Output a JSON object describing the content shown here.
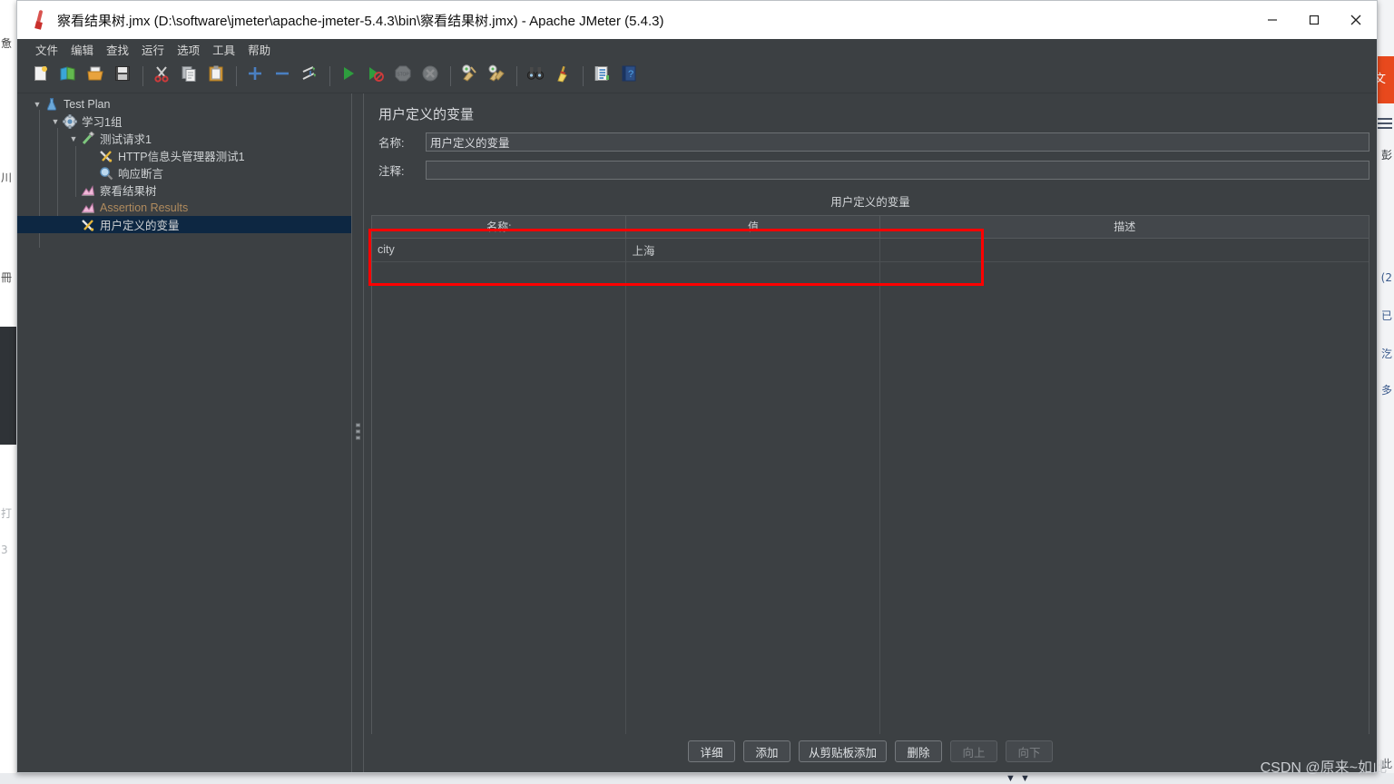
{
  "window": {
    "title": "察看结果树.jmx (D:\\software\\jmeter\\apache-jmeter-5.4.3\\bin\\察看结果树.jmx) - Apache JMeter (5.4.3)",
    "app_icon": "jmeter-feather-icon",
    "controls": {
      "minimize": "minimize-icon",
      "maximize": "maximize-icon",
      "close": "close-icon"
    }
  },
  "menubar": {
    "items": [
      {
        "label": "文件",
        "name": "menu-file"
      },
      {
        "label": "编辑",
        "name": "menu-edit"
      },
      {
        "label": "查找",
        "name": "menu-search"
      },
      {
        "label": "运行",
        "name": "menu-run"
      },
      {
        "label": "选项",
        "name": "menu-options"
      },
      {
        "label": "工具",
        "name": "menu-tools"
      },
      {
        "label": "帮助",
        "name": "menu-help"
      }
    ]
  },
  "toolbar": {
    "buttons": [
      {
        "icon": "new-document-icon",
        "name": "toolbar-new",
        "enabled": true
      },
      {
        "icon": "templates-icon",
        "name": "toolbar-templates",
        "enabled": true
      },
      {
        "icon": "open-folder-icon",
        "name": "toolbar-open",
        "enabled": true
      },
      {
        "icon": "save-floppy-icon",
        "name": "toolbar-save",
        "enabled": true
      },
      {
        "icon": "separator",
        "name": "toolbar-separator-1",
        "enabled": true
      },
      {
        "icon": "cut-scissors-icon",
        "name": "toolbar-cut",
        "enabled": true
      },
      {
        "icon": "copy-icon",
        "name": "toolbar-copy",
        "enabled": true
      },
      {
        "icon": "paste-clipboard-icon",
        "name": "toolbar-paste",
        "enabled": true
      },
      {
        "icon": "separator",
        "name": "toolbar-separator-2",
        "enabled": true
      },
      {
        "icon": "expand-plus-icon",
        "name": "toolbar-expand-all",
        "enabled": true
      },
      {
        "icon": "collapse-minus-icon",
        "name": "toolbar-collapse-all",
        "enabled": true
      },
      {
        "icon": "toggle-icon",
        "name": "toolbar-toggle",
        "enabled": true
      },
      {
        "icon": "separator",
        "name": "toolbar-separator-3",
        "enabled": true
      },
      {
        "icon": "start-play-icon",
        "name": "toolbar-start",
        "enabled": true
      },
      {
        "icon": "start-no-timers-icon",
        "name": "toolbar-start-no-pauses",
        "enabled": true
      },
      {
        "icon": "stop-icon",
        "name": "toolbar-stop",
        "enabled": false
      },
      {
        "icon": "shutdown-icon",
        "name": "toolbar-shutdown",
        "enabled": false
      },
      {
        "icon": "separator",
        "name": "toolbar-separator-4",
        "enabled": true
      },
      {
        "icon": "clear-broom-icon",
        "name": "toolbar-clear",
        "enabled": true
      },
      {
        "icon": "clear-all-broom-icon",
        "name": "toolbar-clear-all",
        "enabled": true
      },
      {
        "icon": "separator",
        "name": "toolbar-separator-5",
        "enabled": true
      },
      {
        "icon": "search-binoculars-icon",
        "name": "toolbar-search",
        "enabled": true
      },
      {
        "icon": "reset-search-broom-icon",
        "name": "toolbar-reset-search",
        "enabled": true
      },
      {
        "icon": "separator",
        "name": "toolbar-separator-6",
        "enabled": true
      },
      {
        "icon": "function-helper-icon",
        "name": "toolbar-function-helper",
        "enabled": true
      },
      {
        "icon": "help-book-icon",
        "name": "toolbar-help",
        "enabled": true
      }
    ]
  },
  "tree": {
    "items": [
      {
        "label": "Test Plan",
        "icon": "test-plan-flask-icon",
        "depth": 0,
        "twisty": "expanded",
        "selected": false,
        "muted": false
      },
      {
        "label": "学习1组",
        "icon": "thread-group-gear-icon",
        "depth": 1,
        "twisty": "expanded",
        "selected": false,
        "muted": false
      },
      {
        "label": "测试请求1",
        "icon": "http-request-icon",
        "depth": 2,
        "twisty": "expanded",
        "selected": false,
        "muted": false
      },
      {
        "label": "HTTP信息头管理器测试1",
        "icon": "header-manager-icon",
        "depth": 3,
        "twisty": "none",
        "selected": false,
        "muted": false
      },
      {
        "label": "响应断言",
        "icon": "response-assertion-icon",
        "depth": 3,
        "twisty": "none",
        "selected": false,
        "muted": false
      },
      {
        "label": "察看结果树",
        "icon": "view-results-tree-icon",
        "depth": 2,
        "twisty": "none",
        "selected": false,
        "muted": false
      },
      {
        "label": "Assertion Results",
        "icon": "assertion-results-icon",
        "depth": 2,
        "twisty": "none",
        "selected": false,
        "muted": true
      },
      {
        "label": "用户定义的变量",
        "icon": "user-variables-icon",
        "depth": 2,
        "twisty": "none",
        "selected": true,
        "muted": false
      }
    ]
  },
  "panel": {
    "title": "用户定义的变量",
    "name_label": "名称:",
    "name_value": "用户定义的变量",
    "comment_label": "注释:",
    "comment_value": "",
    "comment_placeholder": "",
    "table_caption": "用户定义的变量",
    "table": {
      "headers": [
        "名称:",
        "值",
        "描述"
      ],
      "rows": [
        {
          "name": "city",
          "value": "上海",
          "description": ""
        }
      ]
    },
    "buttons": [
      {
        "label": "详细",
        "name": "detail-button",
        "enabled": true
      },
      {
        "label": "添加",
        "name": "add-button",
        "enabled": true
      },
      {
        "label": "从剪贴板添加",
        "name": "add-from-clipboard-button",
        "enabled": true
      },
      {
        "label": "删除",
        "name": "delete-button",
        "enabled": true
      },
      {
        "label": "向上",
        "name": "move-up-button",
        "enabled": false
      },
      {
        "label": "向下",
        "name": "move-down-button",
        "enabled": false
      }
    ]
  },
  "annotation": {
    "color": "#ff0000",
    "description": "red-rectangle-highlighting-variable-row"
  },
  "watermark": {
    "text": "CSDN @原来~如此"
  },
  "background": {
    "left_glyphs": [
      "惫",
      "川",
      "冊"
    ],
    "right_orange_glyph": "文",
    "right_glyphs": [
      "(2",
      "已",
      "汔",
      "多"
    ],
    "bottom_glyph": "此"
  },
  "colors": {
    "window_bg": "#3c4043",
    "panel_bg": "#43474b",
    "selection": "#0d2742",
    "text": "#d0d3d6",
    "muted_text": "#b08b5e",
    "border": "#55595c",
    "annotation_red": "#ff0000",
    "accent_orange": "#e8491d"
  }
}
